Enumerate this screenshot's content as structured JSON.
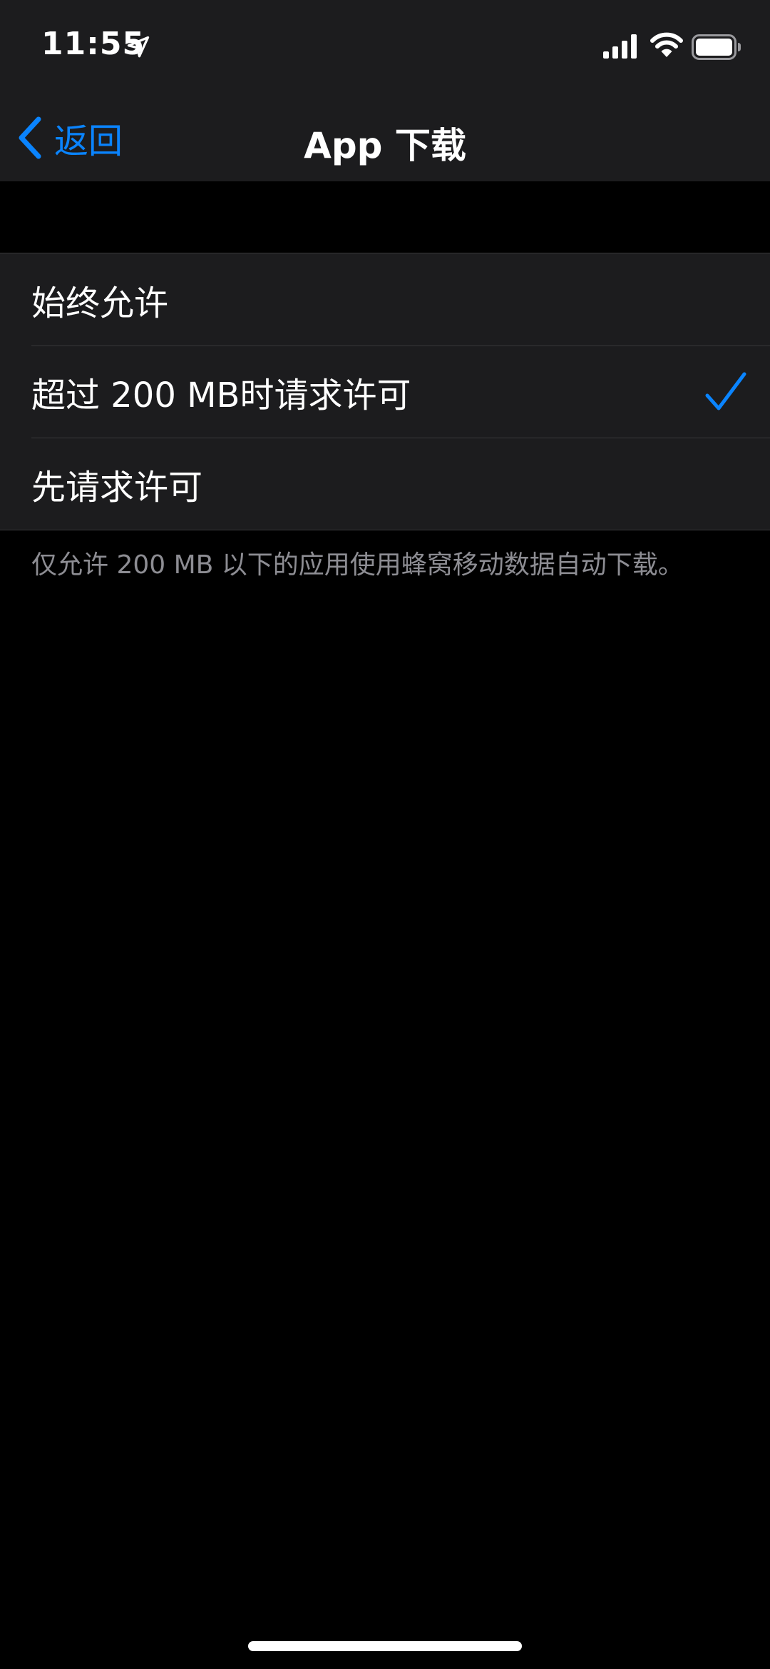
{
  "status_bar": {
    "time": "11:55",
    "icons": [
      "location-arrow-icon",
      "cellular-signal-icon",
      "wifi-icon",
      "battery-icon"
    ]
  },
  "nav": {
    "back_label": "返回",
    "title": "App 下载"
  },
  "options": [
    {
      "label": "始终允许",
      "selected": false
    },
    {
      "label": "超过 200 MB时请求许可",
      "selected": true
    },
    {
      "label": "先请求许可",
      "selected": false
    }
  ],
  "footer_note": "仅允许 200 MB 以下的应用使用蜂窝移动数据自动下载。",
  "colors": {
    "accent": "#0a84ff",
    "background": "#000000",
    "grouped_background": "#1c1c1e",
    "separator": "#38383a",
    "secondary_text": "#8d8d93"
  }
}
